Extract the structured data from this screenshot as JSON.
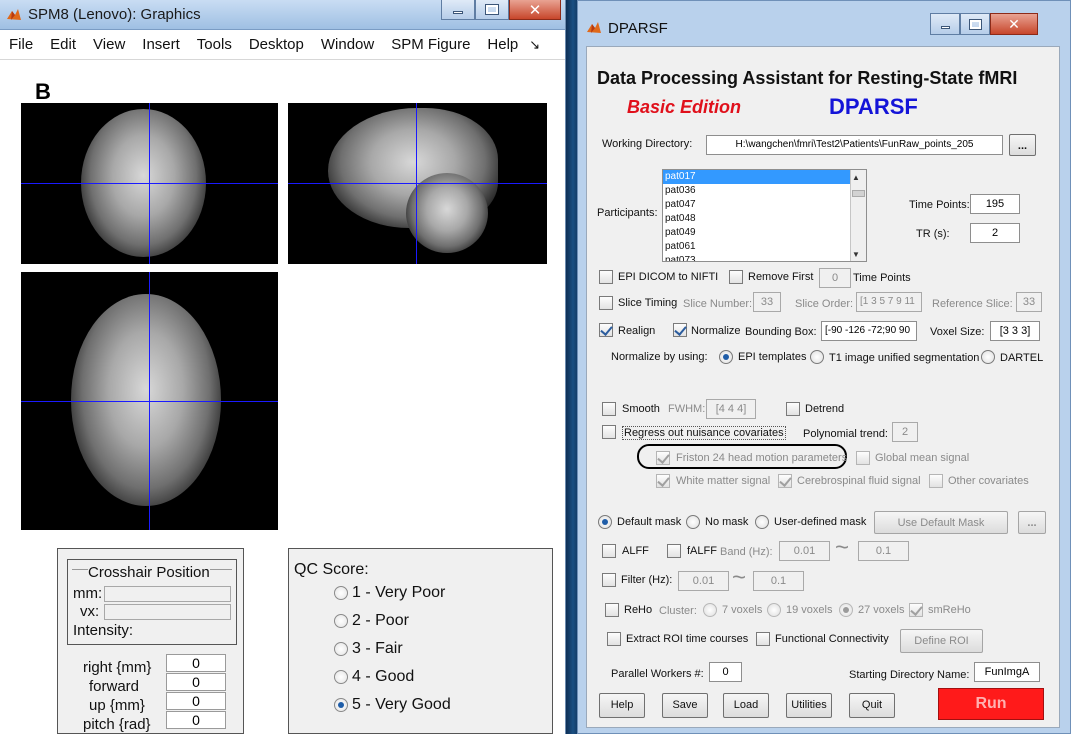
{
  "spm": {
    "title": "SPM8 (Lenovo): Graphics",
    "menu": [
      "File",
      "Edit",
      "View",
      "Insert",
      "Tools",
      "Desktop",
      "Window",
      "SPM Figure",
      "Help"
    ],
    "figure_label": "B",
    "crosshair": {
      "heading": "Crosshair Position",
      "mm_label": "mm:",
      "vx_label": "vx:",
      "intensity_label": "Intensity:"
    },
    "params": [
      {
        "label": "right  {mm}",
        "value": "0"
      },
      {
        "label": "forward",
        "value": "0"
      },
      {
        "label": "up  {mm}",
        "value": "0"
      },
      {
        "label": "pitch  {rad}",
        "value": "0"
      }
    ],
    "qc": {
      "title": "QC Score:",
      "options": [
        "1 - Very Poor",
        "2 - Poor",
        "3 - Fair",
        "4 - Good",
        "5 - Very Good"
      ],
      "selected": "5 - Very Good"
    }
  },
  "dparsf": {
    "window_title": "DPARSF",
    "heading": "Data Processing Assistant for Resting-State fMRI",
    "edition": "Basic Edition",
    "product": "DPARSF",
    "colors": {
      "edition": "#e0101b",
      "product": "#1414d8",
      "run_bg": "#ff1a1a",
      "run_text": "#ffb0b0"
    },
    "working_dir_label": "Working Directory:",
    "working_dir": "H:\\wangchen\\fmri\\Test2\\Patients\\FunRaw_points_205",
    "browse": "...",
    "participants_label": "Participants:",
    "participants": [
      "pat017",
      "pat036",
      "pat047",
      "pat048",
      "pat049",
      "pat061",
      "pat073"
    ],
    "time_points_label": "Time Points:",
    "time_points": "195",
    "tr_label": "TR (s):",
    "tr": "2",
    "epi_dicom": "EPI DICOM to NIFTI",
    "remove_first": "Remove First",
    "remove_first_value": "0",
    "time_points_suffix": "Time Points",
    "slice_timing": "Slice Timing",
    "slice_number_label": "Slice Number:",
    "slice_number": "33",
    "slice_order_label": "Slice Order:",
    "slice_order": "[1 3 5 7 9 11",
    "reference_slice_label": "Reference Slice:",
    "reference_slice": "33",
    "realign": "Realign",
    "normalize": "Normalize",
    "bounding_box_label": "Bounding Box:",
    "bounding_box": "[-90 -126 -72;90 90",
    "voxel_size_label": "Voxel Size:",
    "voxel_size": "[3 3 3]",
    "normalize_by": "Normalize by using:",
    "norm_options": [
      "EPI templates",
      "T1 image unified segmentation",
      "DARTEL"
    ],
    "smooth": "Smooth",
    "fwhm_label": "FWHM:",
    "fwhm": "[4 4 4]",
    "detrend": "Detrend",
    "regress": "Regress out nuisance covariates",
    "poly_label": "Polynomial trend:",
    "poly": "2",
    "friston": "Friston 24 head motion parameters",
    "global_mean": "Global mean signal",
    "white_matter": "White matter signal",
    "csf": "Cerebrospinal fluid signal",
    "other_cov": "Other covariates",
    "mask_options": [
      "Default mask",
      "No mask",
      "User-defined mask"
    ],
    "use_default_mask": "Use Default Mask",
    "alff": "ALFF",
    "falff": "fALFF",
    "band_label": "Band (Hz):",
    "band_low": "0.01",
    "band_high": "0.1",
    "tilde": "~",
    "filter": "Filter (Hz):",
    "filter_low": "0.01",
    "filter_high": "0.1",
    "reho": "ReHo",
    "cluster_label": "Cluster:",
    "cluster_options": [
      "7 voxels",
      "19 voxels",
      "27 voxels"
    ],
    "smreho": "smReHo",
    "extract_roi": "Extract ROI time courses",
    "functional_conn": "Functional Connectivity",
    "define_roi": "Define ROI",
    "parallel_label": "Parallel Workers #:",
    "parallel": "0",
    "start_dir_label": "Starting Directory Name:",
    "start_dir": "FunImgA",
    "buttons": [
      "Help",
      "Save",
      "Load",
      "Utilities",
      "Quit"
    ],
    "run": "Run"
  }
}
